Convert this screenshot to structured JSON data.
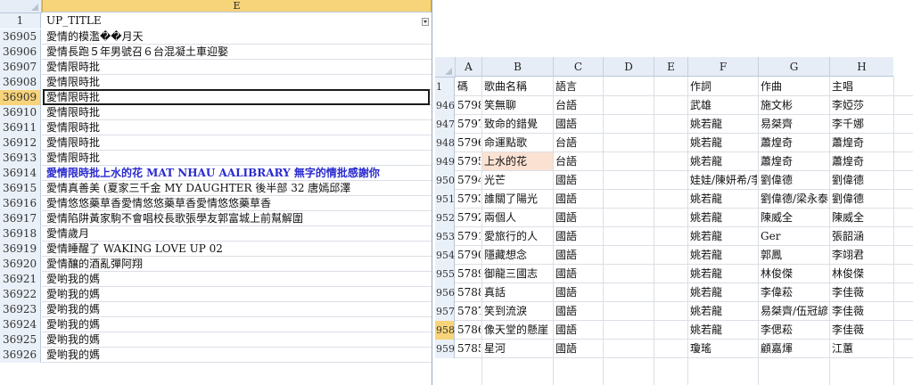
{
  "left": {
    "col_header": "E",
    "header_row_num": "1",
    "header_title": "UP_TITLE",
    "rows": [
      {
        "num": "36905",
        "text": "愛情的模濫��月天"
      },
      {
        "num": "36906",
        "text": "愛情長跑５年男號召６台混凝土車迎娶"
      },
      {
        "num": "36907",
        "text": "愛情限時批"
      },
      {
        "num": "36908",
        "text": "愛情限時批"
      },
      {
        "num": "36909",
        "text": "愛情限時批"
      },
      {
        "num": "36910",
        "text": "愛情限時批"
      },
      {
        "num": "36911",
        "text": "愛情限時批"
      },
      {
        "num": "36912",
        "text": "愛情限時批"
      },
      {
        "num": "36913",
        "text": "愛情限時批"
      },
      {
        "num": "36914",
        "text": "愛情限時批上水的花 MAT NHAU AALIBRARY 無字的情批感謝你"
      },
      {
        "num": "36915",
        "text": "愛情真善美 (夏家三千金 MY DAUGHTER 後半部 32 唐嫣邱澤"
      },
      {
        "num": "36916",
        "text": "愛情悠悠藥草香愛情悠悠藥草香愛情悠悠藥草香"
      },
      {
        "num": "36917",
        "text": "愛情陷阱黃家駒不會唱校長歌張學友郭富城上前幫解圍"
      },
      {
        "num": "36918",
        "text": "愛情歲月"
      },
      {
        "num": "36919",
        "text": "愛情睡醒了 WAKING LOVE UP 02"
      },
      {
        "num": "36920",
        "text": "愛情釀的酒亂彈阿翔"
      },
      {
        "num": "36921",
        "text": "愛喲我的媽"
      },
      {
        "num": "36922",
        "text": "愛喲我的媽"
      },
      {
        "num": "36923",
        "text": "愛喲我的媽"
      },
      {
        "num": "36924",
        "text": "愛喲我的媽"
      },
      {
        "num": "36925",
        "text": "愛喲我的媽"
      },
      {
        "num": "36926",
        "text": "愛喲我的媽"
      }
    ]
  },
  "right": {
    "columns": [
      "A",
      "B",
      "C",
      "D",
      "E",
      "F",
      "G",
      "H"
    ],
    "header_row": {
      "num": "1",
      "A": "碼",
      "B": "歌曲名稱",
      "C": "語言",
      "F": "作詞",
      "G": "作曲",
      "H": "主唱"
    },
    "rows": [
      {
        "num": "946",
        "A": "5798",
        "B": "笑無聊",
        "C": "台語",
        "F": "武雄",
        "G": "施文彬",
        "H": "李婭莎"
      },
      {
        "num": "947",
        "A": "5797",
        "B": "致命的錯覺",
        "C": "國語",
        "F": "姚若龍",
        "G": "易桀齊",
        "H": "李千娜"
      },
      {
        "num": "948",
        "A": "5796",
        "B": "命運點歌",
        "C": "台語",
        "F": "姚若龍",
        "G": "蕭煌奇",
        "H": "蕭煌奇"
      },
      {
        "num": "949",
        "A": "5795",
        "B": "上水的花",
        "C": "台語",
        "F": "姚若龍",
        "G": "蕭煌奇",
        "H": "蕭煌奇"
      },
      {
        "num": "950",
        "A": "5794",
        "B": "光芒",
        "C": "國語",
        "F": "娃娃/陳妍希/李",
        "G": "劉偉德",
        "H": "劉偉德"
      },
      {
        "num": "951",
        "A": "5793",
        "B": "誰關了陽光",
        "C": "國語",
        "F": "姚若龍",
        "G": "劉偉德/梁永泰",
        "H": "劉偉德"
      },
      {
        "num": "952",
        "A": "5792",
        "B": "兩個人",
        "C": "國語",
        "F": "姚若龍",
        "G": "陳威全",
        "H": "陳威全"
      },
      {
        "num": "953",
        "A": "5791",
        "B": "愛旅行的人",
        "C": "國語",
        "F": "姚若龍",
        "G": "Ger",
        "H": "張韶涵"
      },
      {
        "num": "954",
        "A": "5790",
        "B": "隱藏想念",
        "C": "國語",
        "F": "姚若龍",
        "G": "郭鳳",
        "H": "李翊君"
      },
      {
        "num": "955",
        "A": "5789",
        "B": "御龍三國志",
        "C": "國語",
        "F": "姚若龍",
        "G": "林俊傑",
        "H": "林俊傑"
      },
      {
        "num": "956",
        "A": "5788",
        "B": "真話",
        "C": "國語",
        "F": "姚若龍",
        "G": "李偉菘",
        "H": "李佳薇"
      },
      {
        "num": "957",
        "A": "5787",
        "B": "笑到流淚",
        "C": "國語",
        "F": "姚若龍",
        "G": "易桀齊/伍冠諺",
        "H": "李佳薇"
      },
      {
        "num": "958",
        "A": "5786",
        "B": "像天堂的懸崖",
        "C": "國語",
        "F": "姚若龍",
        "G": "李偲菘",
        "H": "李佳薇"
      },
      {
        "num": "959",
        "A": "5785",
        "B": "星河",
        "C": "國語",
        "F": "瓊瑤",
        "G": "顧嘉煇",
        "H": "江蕙"
      }
    ]
  },
  "colors": {
    "header_bg": "#e6edf6",
    "active_col_bg": "#f7d37a",
    "active_row_hdr": "#f7d37a",
    "highlight_text": "#2a2ad0",
    "cell_highlight": "#fbe1d2"
  }
}
